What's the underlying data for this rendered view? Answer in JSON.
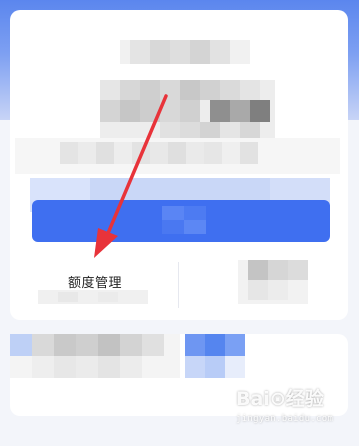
{
  "page": {
    "quota_management_label": "额度管理"
  },
  "watermark": {
    "main": "Bai⊙经验",
    "sub": "jingyan.baidu.com"
  },
  "colors": {
    "header_blue": "#5b86ee",
    "primary_button": "#3f6ff0",
    "arrow_red": "#e8333a",
    "card_bg": "#ffffff",
    "page_bg": "#f3f5fa"
  },
  "icons": {
    "annotation": "red-arrow-annotation"
  }
}
